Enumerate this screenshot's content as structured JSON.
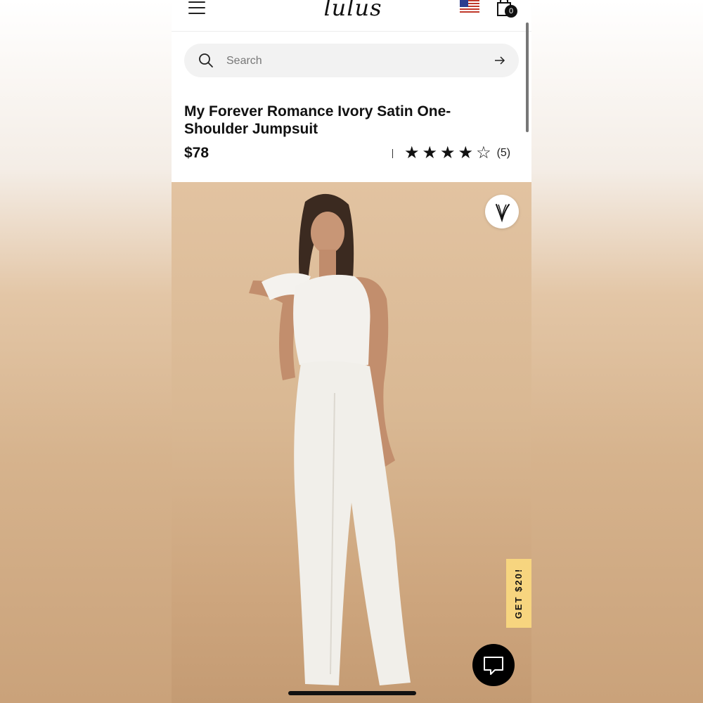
{
  "header": {
    "logo_text": "lulus",
    "menu_icon": "hamburger-menu-icon",
    "flag_icon": "us-flag-icon",
    "cart_icon": "shopping-bag-icon",
    "cart_count": "0"
  },
  "search": {
    "placeholder": "Search",
    "icon": "search-icon",
    "submit_icon": "arrow-right-icon"
  },
  "product": {
    "title": "My Forever Romance Ivory Satin One-Shoulder Jumpsuit",
    "price": "$78",
    "rating": {
      "value": 4,
      "max": 5,
      "review_count": "(5)"
    }
  },
  "image": {
    "favorite_icon": "heart-icon",
    "promo_label": "GET $20!",
    "chat_icon": "chat-bubble-icon"
  },
  "colors": {
    "accent": "#111111",
    "promo": "#f7d57f",
    "search_bg": "#f2f2f2"
  }
}
